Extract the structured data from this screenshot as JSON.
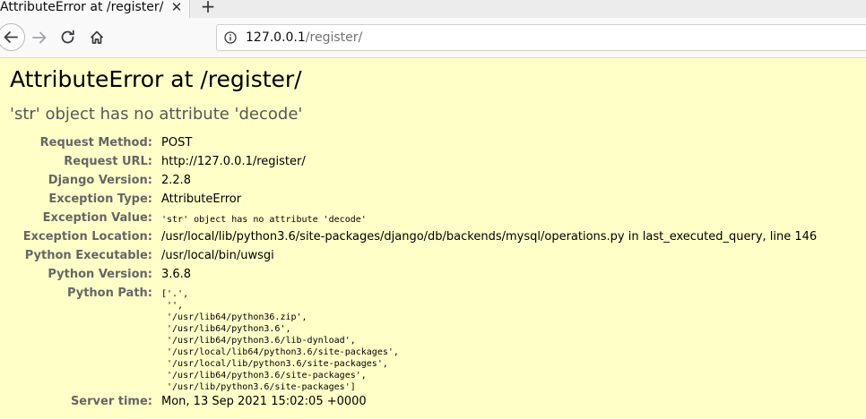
{
  "browser": {
    "tab_title": "AttributeError at /register/",
    "tab_close": "✕",
    "new_tab": "+",
    "url_host": "127.0.0.1",
    "url_path": "/register/"
  },
  "error": {
    "title": "AttributeError at /register/",
    "value": "'str' object has no attribute 'decode'"
  },
  "meta": [
    {
      "label": "Request Method:",
      "value": "POST"
    },
    {
      "label": "Request URL:",
      "value": "http://127.0.0.1/register/"
    },
    {
      "label": "Django Version:",
      "value": "2.2.8"
    },
    {
      "label": "Exception Type:",
      "value": "AttributeError"
    },
    {
      "label": "Exception Value:",
      "value": "'str' object has no attribute 'decode'"
    },
    {
      "label": "Exception Location:",
      "value": "/usr/local/lib/python3.6/site-packages/django/db/backends/mysql/operations.py in last_executed_query, line 146"
    },
    {
      "label": "Python Executable:",
      "value": "/usr/local/bin/uwsgi"
    },
    {
      "label": "Python Version:",
      "value": "3.6.8"
    },
    {
      "label": "Python Path:",
      "value": "['.',\n '',\n '/usr/lib64/python36.zip',\n '/usr/lib64/python3.6',\n '/usr/lib64/python3.6/lib-dynload',\n '/usr/local/lib64/python3.6/site-packages',\n '/usr/local/lib/python3.6/site-packages',\n '/usr/lib64/python3.6/site-packages',\n '/usr/lib/python3.6/site-packages']"
    },
    {
      "label": "Server time:",
      "value": "Mon, 13 Sep 2021 15:02:05 +0000"
    }
  ]
}
